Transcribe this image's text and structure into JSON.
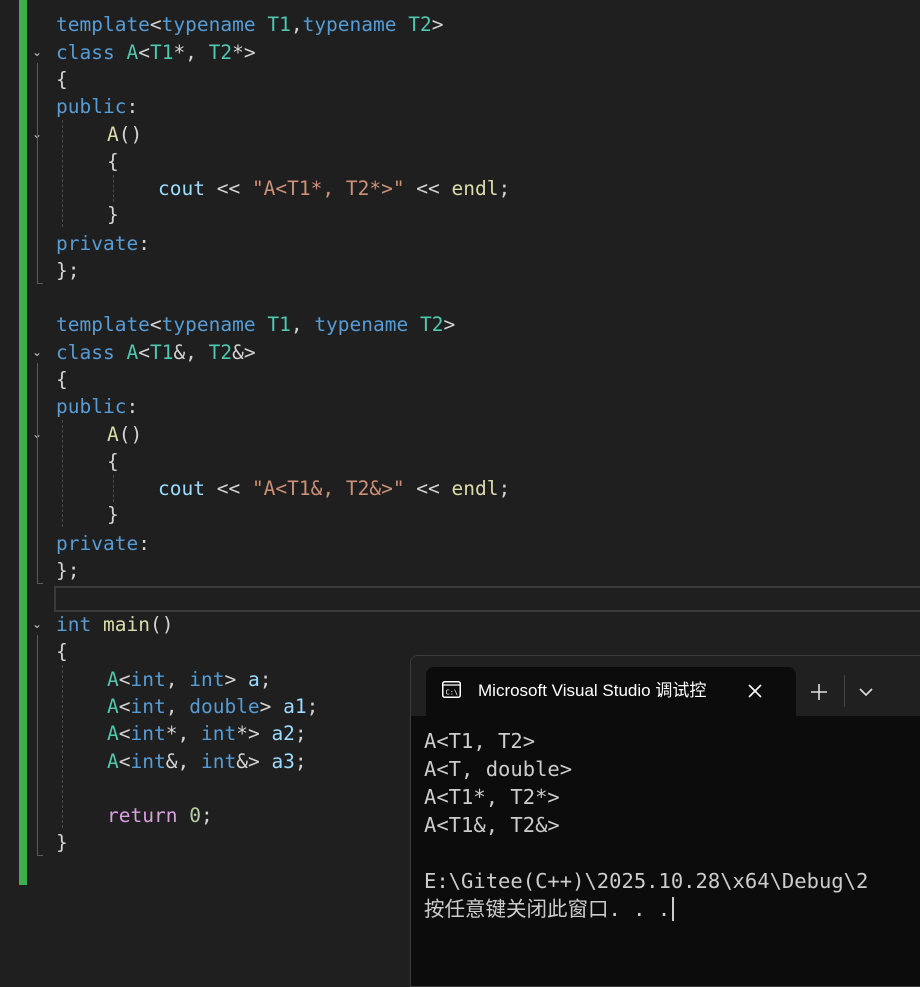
{
  "editor": {
    "lines": [
      {
        "t1": "template",
        "t2": "<",
        "t3": "typename",
        "t4": " ",
        "t5": "T1",
        "t6": ",",
        "t7": "typename",
        "t8": " ",
        "t9": "T2",
        "t10": ">"
      },
      {
        "t1": "class",
        "t2": " ",
        "t3": "A",
        "t4": "<",
        "t5": "T1",
        "t6": "*, ",
        "t7": "T2",
        "t8": "*>"
      },
      {
        "t1": "{"
      },
      {
        "t1": "public",
        "t2": ":"
      },
      {
        "t1": "A",
        "t2": "()"
      },
      {
        "t1": "{"
      },
      {
        "t1": "cout",
        "t2": " << ",
        "t3": "\"A<T1*, T2*>\"",
        "t4": " << ",
        "t5": "endl",
        "t6": ";"
      },
      {
        "t1": "}"
      },
      {
        "t1": "private",
        "t2": ":"
      },
      {
        "t1": "};"
      },
      {
        "t1": "template",
        "t2": "<",
        "t3": "typename",
        "t4": " ",
        "t5": "T1",
        "t6": ", ",
        "t7": "typename",
        "t8": " ",
        "t9": "T2",
        "t10": ">"
      },
      {
        "t1": "class",
        "t2": " ",
        "t3": "A",
        "t4": "<",
        "t5": "T1",
        "t6": "&, ",
        "t7": "T2",
        "t8": "&>"
      },
      {
        "t1": "{"
      },
      {
        "t1": "public",
        "t2": ":"
      },
      {
        "t1": "A",
        "t2": "()"
      },
      {
        "t1": "{"
      },
      {
        "t1": "cout",
        "t2": " << ",
        "t3": "\"A<T1&, T2&>\"",
        "t4": " << ",
        "t5": "endl",
        "t6": ";"
      },
      {
        "t1": "}"
      },
      {
        "t1": "private",
        "t2": ":"
      },
      {
        "t1": "};"
      },
      {
        "t1": "int",
        "t2": " ",
        "t3": "main",
        "t4": "()"
      },
      {
        "t1": "{"
      },
      {
        "t1": "A",
        "t2": "<",
        "t3": "int",
        "t4": ", ",
        "t5": "int",
        "t6": "> ",
        "t7": "a",
        "t8": ";"
      },
      {
        "t1": "A",
        "t2": "<",
        "t3": "int",
        "t4": ", ",
        "t5": "double",
        "t6": "> ",
        "t7": "a1",
        "t8": ";"
      },
      {
        "t1": "A",
        "t2": "<",
        "t3": "int",
        "t4": "*, ",
        "t5": "int",
        "t6": "*> ",
        "t7": "a2",
        "t8": ";"
      },
      {
        "t1": "A",
        "t2": "<",
        "t3": "int",
        "t4": "&, ",
        "t5": "int",
        "t6": "&> ",
        "t7": "a3",
        "t8": ";"
      },
      {
        "t1": "return",
        "t2": " ",
        "t3": "0",
        "t4": ";"
      },
      {
        "t1": "}"
      }
    ]
  },
  "terminal": {
    "tab_title": "Microsoft Visual Studio 调试控",
    "tab_icon": "console-icon",
    "output": [
      "A<T1, T2>",
      "A<T, double>",
      "A<T1*, T2*>",
      "A<T1&, T2&>",
      "",
      "E:\\Gitee(C++)\\2025.10.28\\x64\\Debug\\2",
      "按任意键关闭此窗口. . ."
    ]
  },
  "colors": {
    "editor_bg": "#1f1f1f",
    "change_bar": "#3fae4c",
    "keyword": "#569cd6",
    "type": "#4ec9b0",
    "function": "#dcdcaa",
    "string": "#ce9178",
    "control": "#d8a0df",
    "variable": "#9cdcfe",
    "number": "#b5cea8",
    "terminal_bg": "#0c0c0c"
  }
}
